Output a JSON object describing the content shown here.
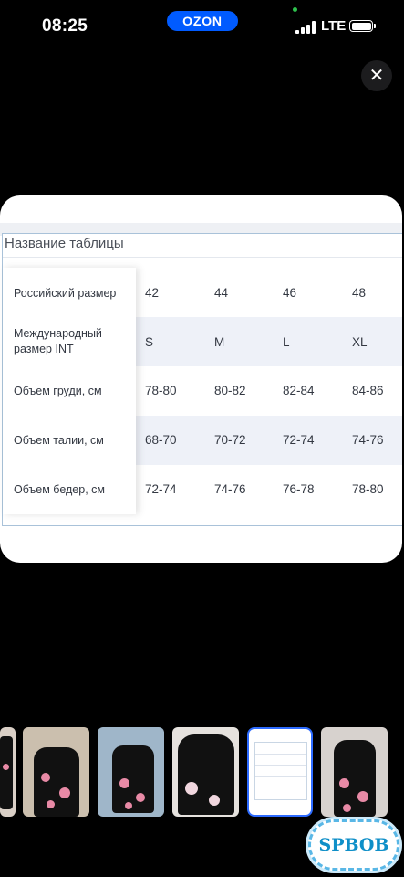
{
  "status_bar": {
    "time": "08:25",
    "network": "LTE"
  },
  "header": {
    "brand": "OZON",
    "brand_color": "#005bff",
    "close_icon": "close-icon"
  },
  "size_table": {
    "title": "Название таблицы",
    "rows": [
      {
        "label": "Российский размер",
        "values": [
          "42",
          "44",
          "46",
          "48"
        ]
      },
      {
        "label": "Международный размер INT",
        "values": [
          "S",
          "M",
          "L",
          "XL"
        ]
      },
      {
        "label": "Объем груди, см",
        "values": [
          "78-80",
          "80-82",
          "82-84",
          "84-86"
        ]
      },
      {
        "label": "Объем талии, см",
        "values": [
          "68-70",
          "70-72",
          "72-74",
          "74-76"
        ]
      },
      {
        "label": "Объем бедер, см",
        "values": [
          "72-74",
          "74-76",
          "76-78",
          "78-80"
        ]
      }
    ]
  },
  "gallery": {
    "thumbnails": [
      "swimsuit-photo",
      "swimsuit-photo",
      "swimsuit-photo",
      "swimsuit-photo",
      "size-table-image",
      "swimsuit-photo"
    ],
    "selected_index": 4
  },
  "watermark": {
    "text": "SPBOB"
  }
}
